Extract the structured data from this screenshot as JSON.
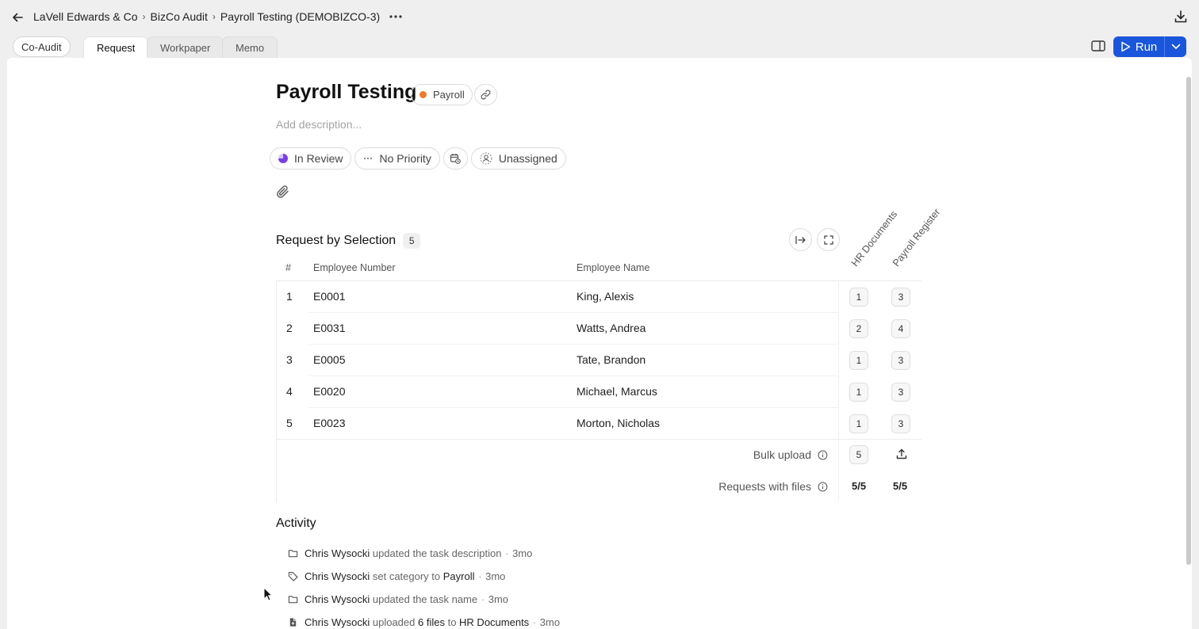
{
  "breadcrumb": {
    "items": [
      "LaVell Edwards & Co",
      "BizCo Audit",
      "Payroll Testing (DEMOBIZCO-3)"
    ],
    "separator": "›"
  },
  "tabs": {
    "coaudit": "Co-Audit",
    "items": [
      "Request",
      "Workpaper",
      "Memo"
    ],
    "active": "Request"
  },
  "toolbar": {
    "run_label": "Run"
  },
  "task": {
    "title": "Payroll Testing",
    "category": "Payroll",
    "category_color": "#f07a2c",
    "description_placeholder": "Add description...",
    "status": "In Review",
    "priority": "No Priority",
    "assignee": "Unassigned"
  },
  "request_table": {
    "title": "Request by Selection",
    "count": "5",
    "columns": [
      "#",
      "Employee Number",
      "Employee Name"
    ],
    "doc_columns": [
      "HR Documents",
      "Payroll Register"
    ],
    "rows": [
      {
        "idx": "1",
        "number": "E0001",
        "name": "King, Alexis",
        "hr": "1",
        "pr": "3"
      },
      {
        "idx": "2",
        "number": "E0031",
        "name": "Watts, Andrea",
        "hr": "2",
        "pr": "4"
      },
      {
        "idx": "3",
        "number": "E0005",
        "name": "Tate, Brandon",
        "hr": "1",
        "pr": "3"
      },
      {
        "idx": "4",
        "number": "E0020",
        "name": "Michael, Marcus",
        "hr": "1",
        "pr": "3"
      },
      {
        "idx": "5",
        "number": "E0023",
        "name": "Morton, Nicholas",
        "hr": "1",
        "pr": "3"
      }
    ],
    "bulk_upload": {
      "label": "Bulk upload",
      "hr": "5"
    },
    "requests_with_files": {
      "label": "Requests with files",
      "hr": "5/5",
      "pr": "5/5"
    }
  },
  "activity": {
    "title": "Activity",
    "items": [
      {
        "icon": "folder-icon",
        "who": "Chris Wysocki",
        "text": "updated the task description",
        "time": "3mo"
      },
      {
        "icon": "tag-icon",
        "who": "Chris Wysocki",
        "text": "set category to",
        "target": "Payroll",
        "time": "3mo"
      },
      {
        "icon": "folder-icon",
        "who": "Chris Wysocki",
        "text": "updated the task name",
        "time": "3mo"
      },
      {
        "icon": "file-icon",
        "who": "Chris Wysocki",
        "text": "uploaded",
        "files": "6 files",
        "to": "to",
        "target": "HR Documents",
        "time": "3mo"
      }
    ]
  },
  "colors": {
    "accent": "#1a56db",
    "status_purple": "#7b3fe4"
  }
}
